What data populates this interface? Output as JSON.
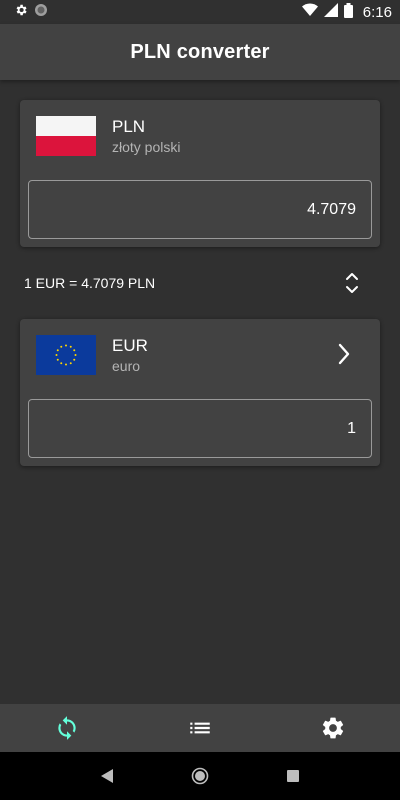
{
  "status_bar": {
    "time": "6:16",
    "icons": [
      "settings-icon",
      "circle-icon",
      "wifi-icon",
      "signal-icon",
      "battery-icon"
    ]
  },
  "app_bar": {
    "title": "PLN converter"
  },
  "from_currency": {
    "code": "PLN",
    "name": "złoty polski",
    "amount": "4.7079",
    "flag": "poland-flag-icon"
  },
  "rate": {
    "text": "1 EUR = 4.7079 PLN"
  },
  "to_currency": {
    "code": "EUR",
    "name": "euro",
    "amount": "1",
    "flag": "eu-flag-icon"
  },
  "bottom_nav": {
    "items": [
      "sync-icon",
      "list-icon",
      "settings-icon"
    ],
    "active": "sync-icon",
    "accent": "#64ffda"
  },
  "colors": {
    "background": "#303030",
    "surface": "#424242",
    "text_secondary": "#b4b4b4"
  }
}
